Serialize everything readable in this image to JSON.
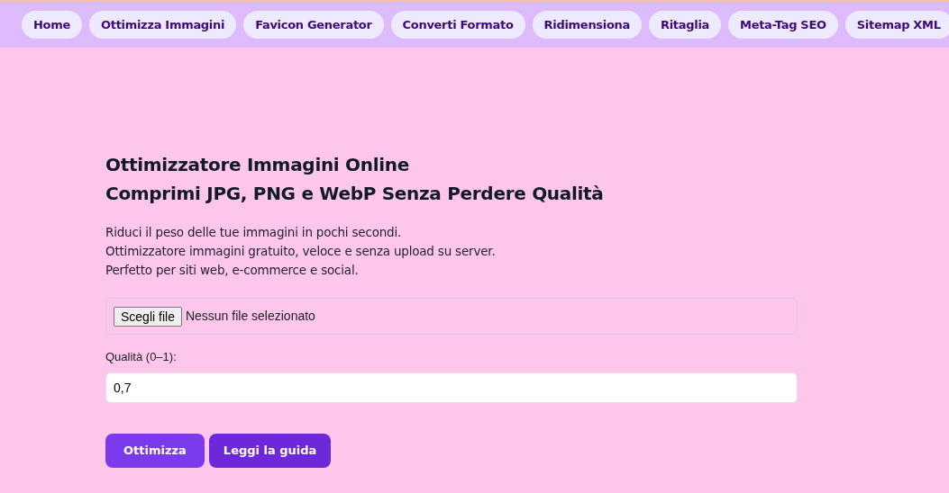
{
  "nav": [
    {
      "label": "Home"
    },
    {
      "label": "Ottimizza Immagini"
    },
    {
      "label": "Favicon Generator"
    },
    {
      "label": "Converti Formato"
    },
    {
      "label": "Ridimensiona"
    },
    {
      "label": "Ritaglia"
    },
    {
      "label": "Meta-Tag SEO"
    },
    {
      "label": "Sitemap XML"
    }
  ],
  "heading": [
    "Ottimizzatore Immagini Online",
    "Comprimi JPG, PNG e WebP Senza Perdere Qualità"
  ],
  "intro": [
    "Riduci il peso delle tue immagini in pochi secondi.",
    "Ottimizzatore immagini gratuito, veloce e senza upload su server.",
    "Perfetto per siti web, e-commerce e social."
  ],
  "file_input": {
    "button": "Scegli file",
    "status": "Nessun file selezionato"
  },
  "quality": {
    "label": "Qualità (0–1):",
    "value": "0,7"
  },
  "buttons": [
    {
      "label": "Ottimizza",
      "kind": "primary"
    },
    {
      "label": "Leggi la guida",
      "kind": "secondary"
    }
  ]
}
